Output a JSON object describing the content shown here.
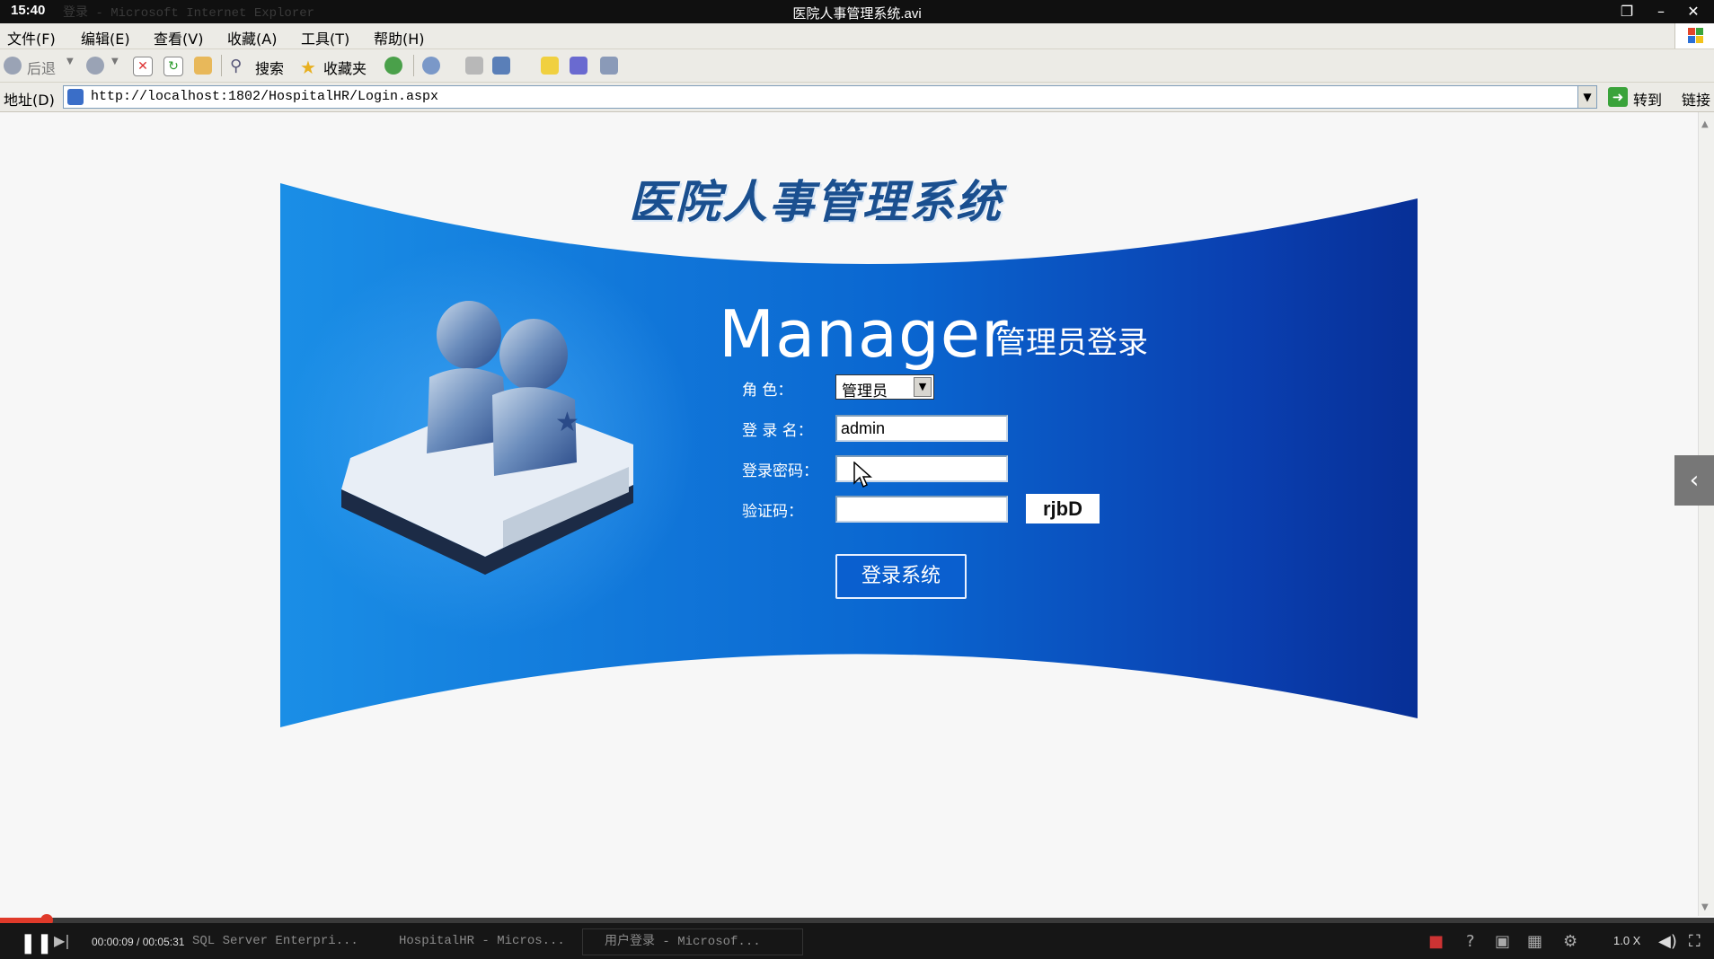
{
  "player": {
    "clock": "15:40",
    "ghost_caption": "登录 - Microsoft Internet Explorer",
    "video_title": "医院人事管理系统.avi",
    "time": "00:00:09 / 00:05:31",
    "progress": 0.027,
    "speed": "1.0 X",
    "tasks": [
      "SQL Server Enterpri...",
      "HospitalHR - Micros...",
      "用户登录 - Microsof..."
    ]
  },
  "menu": {
    "items": [
      "文件(F)",
      "编辑(E)",
      "查看(V)",
      "收藏(A)",
      "工具(T)",
      "帮助(H)"
    ]
  },
  "toolbar": {
    "back_label": "后退",
    "search_label": "搜索",
    "favorites_label": "收藏夹"
  },
  "address": {
    "label": "地址(D)",
    "url": "http://localhost:1802/HospitalHR/Login.aspx",
    "go_label": "转到",
    "links_label": "链接"
  },
  "login": {
    "system_title": "医院人事管理系统",
    "manager_word": "Manager",
    "manager_sub": "管理员登录",
    "role_label": "角    色：",
    "role_value": "管理员",
    "username_label": "登 录 名：",
    "username_value": "admin",
    "password_label": "登录密码：",
    "password_value": "",
    "captcha_label": "验证码：",
    "captcha_value": "",
    "captcha_code": "rjbD",
    "submit_label": "登录系统"
  },
  "colors": {
    "banner_light": "#1a8ee6",
    "banner_dark": "#0a3aa0",
    "title_blue": "#1a4f8f",
    "progress": "#e03a2a"
  }
}
